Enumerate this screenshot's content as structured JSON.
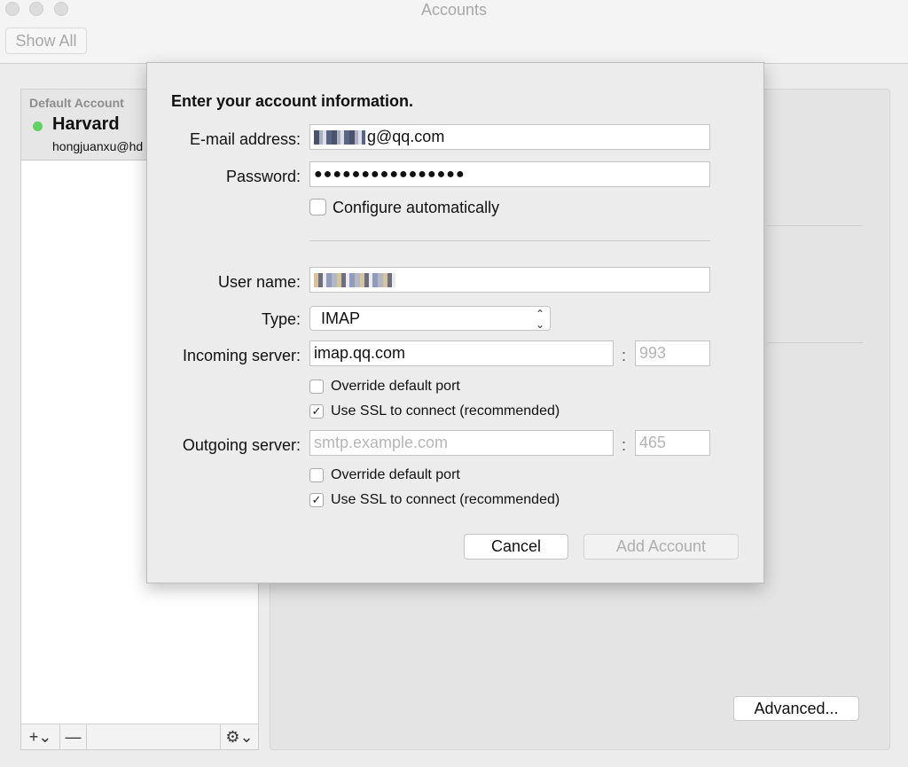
{
  "window": {
    "title": "Accounts",
    "show_all_label": "Show All"
  },
  "accounts": {
    "default_label": "Default Account",
    "selected": {
      "name": "Harvard",
      "email": "hongjuanxu@hd",
      "status_color": "#5fd35f"
    },
    "footer": {
      "add_label": "+⌄",
      "remove_label": "—",
      "gear_label": "⚙⌄"
    }
  },
  "detail": {
    "advanced_label": "Advanced..."
  },
  "sheet": {
    "title": "Enter your account information.",
    "email_label": "E-mail address:",
    "email_value_suffix": "g@qq.com",
    "password_label": "Password:",
    "password_value": "●●●●●●●●●●●●●●●●",
    "configure_auto_label": "Configure automatically",
    "configure_auto_checked": false,
    "username_label": "User name:",
    "type_label": "Type:",
    "type_value": "IMAP",
    "incoming_label": "Incoming server:",
    "incoming_value": "imap.qq.com",
    "incoming_port_placeholder": "993",
    "incoming_override_label": "Override default port",
    "incoming_override_checked": false,
    "incoming_ssl_label": "Use SSL to connect (recommended)",
    "incoming_ssl_checked": true,
    "outgoing_label": "Outgoing server:",
    "outgoing_placeholder": "smtp.example.com",
    "outgoing_port_placeholder": "465",
    "outgoing_override_label": "Override default port",
    "outgoing_override_checked": false,
    "outgoing_ssl_label": "Use SSL to connect (recommended)",
    "outgoing_ssl_checked": true,
    "cancel_label": "Cancel",
    "add_account_label": "Add Account",
    "colon": ":"
  }
}
